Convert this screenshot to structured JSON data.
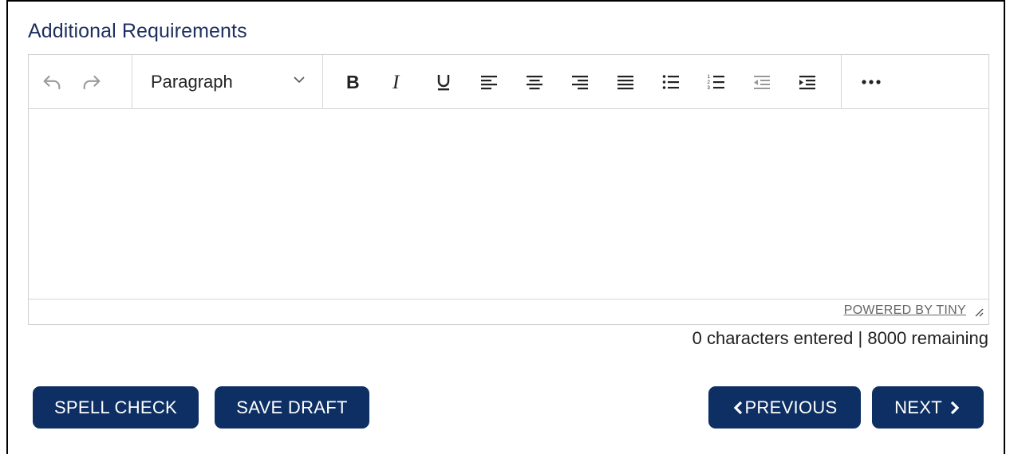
{
  "section": {
    "label": "Additional Requirements"
  },
  "toolbar": {
    "history": [
      {
        "name": "undo-icon"
      },
      {
        "name": "redo-icon"
      }
    ],
    "block_select": {
      "value": "Paragraph",
      "icon": "chevron-down-icon"
    },
    "format_buttons": [
      "bold-icon",
      "italic-icon",
      "underline-icon",
      "align-left-icon",
      "align-center-icon",
      "align-right-icon",
      "align-justify-icon",
      "bullet-list-icon",
      "numbered-list-icon",
      "outdent-icon",
      "indent-icon"
    ],
    "more_icon": "more-horizontal-icon"
  },
  "editor": {
    "content": "",
    "powered_by": "POWERED BY TINY"
  },
  "counter": {
    "text": "0 characters entered | 8000 remaining"
  },
  "actions": {
    "spell_check": "SPELL CHECK",
    "save_draft": "SAVE DRAFT",
    "previous": "PREVIOUS",
    "next": "NEXT"
  },
  "colors": {
    "primary": "#0e2f64",
    "label": "#1d2f5e"
  }
}
